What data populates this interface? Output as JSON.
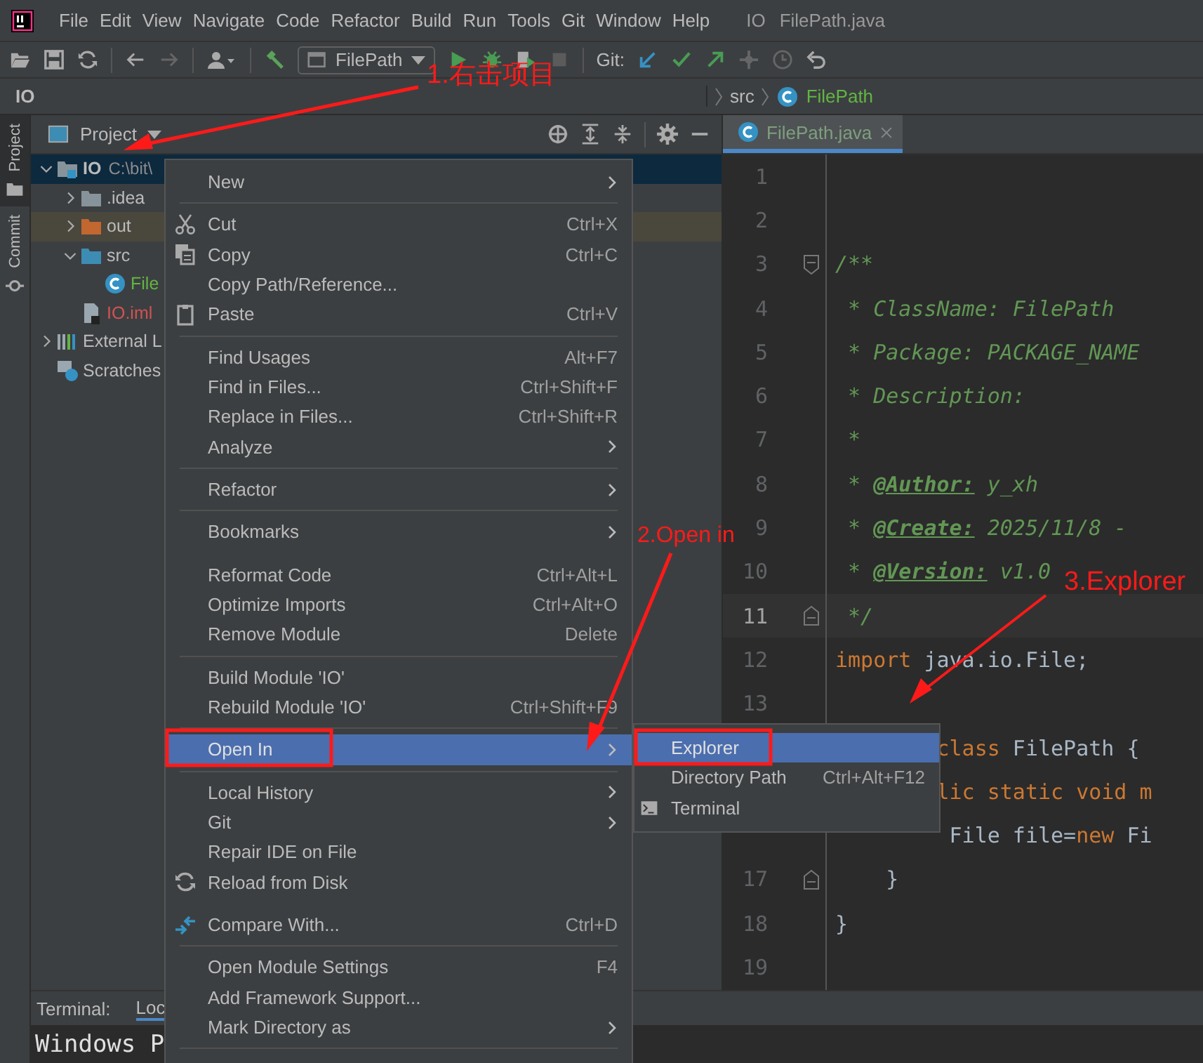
{
  "menubar": {
    "items": [
      "File",
      "Edit",
      "View",
      "Navigate",
      "Code",
      "Refactor",
      "Build",
      "Run",
      "Tools",
      "Git",
      "Window",
      "Help"
    ],
    "project": "IO",
    "file": "FilePath.java"
  },
  "toolbar": {
    "run_config": "FilePath",
    "git_label": "Git:"
  },
  "breadcrumb": [
    {
      "label": "IO",
      "kind": "project"
    },
    {
      "label": "src",
      "kind": "folder"
    },
    {
      "label": "FilePath",
      "kind": "class"
    }
  ],
  "tool_stripe": [
    {
      "label": "Project",
      "selected": true
    },
    {
      "label": "Commit",
      "selected": false
    }
  ],
  "project_panel": {
    "title": "Project",
    "tree": [
      {
        "label": "IO",
        "path": "C:\\bit\\",
        "kind": "module",
        "expanded": true,
        "selected": true,
        "children": [
          {
            "label": ".idea",
            "kind": "folder",
            "expanded": false,
            "selected": false
          },
          {
            "label": "out",
            "kind": "excluded",
            "expanded": false,
            "selected": false
          },
          {
            "label": "src",
            "kind": "source",
            "expanded": true,
            "selected": false,
            "children": [
              {
                "label": "File",
                "kind": "class",
                "selected": false
              }
            ]
          },
          {
            "label": "IO.iml",
            "kind": "iml",
            "selected": false
          }
        ]
      },
      {
        "label": "External L",
        "kind": "libraries",
        "expanded": false,
        "selected": false
      },
      {
        "label": "Scratches",
        "kind": "scratches",
        "selected": false
      }
    ]
  },
  "editor": {
    "tab": {
      "label": "FilePath.java",
      "selected": true
    },
    "lines": [
      {
        "number": "1",
        "current": false
      },
      {
        "number": "2",
        "current": false
      },
      {
        "number": "3",
        "current": false,
        "fold_start": true,
        "tokens": [
          {
            "text": "/**",
            "kind": "comment"
          }
        ]
      },
      {
        "number": "4",
        "current": false,
        "tokens": [
          {
            "text": " * ClassName: FilePath",
            "kind": "comment"
          }
        ]
      },
      {
        "number": "5",
        "current": false,
        "tokens": [
          {
            "text": " * Package: PACKAGE_NAME",
            "kind": "comment"
          }
        ]
      },
      {
        "number": "6",
        "current": false,
        "tokens": [
          {
            "text": " * Description:",
            "kind": "comment"
          }
        ]
      },
      {
        "number": "7",
        "current": false,
        "tokens": [
          {
            "text": " *",
            "kind": "comment"
          }
        ]
      },
      {
        "number": "8",
        "current": false,
        "tokens": [
          {
            "text": " * ",
            "kind": "comment"
          },
          {
            "text": "@Author:",
            "kind": "doctag"
          },
          {
            "text": " y_xh",
            "kind": "comment"
          }
        ]
      },
      {
        "number": "9",
        "current": false,
        "tokens": [
          {
            "text": " * ",
            "kind": "comment"
          },
          {
            "text": "@Create:",
            "kind": "doctag"
          },
          {
            "text": " 2025/11/8 -",
            "kind": "comment"
          }
        ]
      },
      {
        "number": "10",
        "current": false,
        "tokens": [
          {
            "text": " * ",
            "kind": "comment"
          },
          {
            "text": "@Version:",
            "kind": "doctag"
          },
          {
            "text": " v1.0",
            "kind": "comment"
          }
        ]
      },
      {
        "number": "11",
        "current": true,
        "fold_end": true,
        "tokens": [
          {
            "text": " */",
            "kind": "comment"
          }
        ]
      },
      {
        "number": "12",
        "current": false,
        "tokens": [
          {
            "text": "import",
            "kind": "keyword"
          },
          {
            "text": " java.io.File;",
            "kind": "plain"
          }
        ]
      },
      {
        "number": "13",
        "current": false
      },
      {
        "tokens": [
          {
            "text": "        class",
            "kind": "keyword"
          },
          {
            "text": " FilePath {",
            "kind": "plain"
          }
        ]
      },
      {
        "tokens": [
          {
            "text": "        lic static void m",
            "kind": "keyword"
          }
        ]
      },
      {
        "tokens": [
          {
            "text": "         File file=",
            "kind": "plain"
          },
          {
            "text": "new",
            "kind": "keyword"
          },
          {
            "text": " Fi",
            "kind": "plain"
          }
        ]
      },
      {
        "number": "17",
        "current": false,
        "fold_end": true,
        "tokens": [
          {
            "text": "    }",
            "kind": "plain"
          }
        ]
      },
      {
        "number": "18",
        "current": false,
        "tokens": [
          {
            "text": "}",
            "kind": "plain"
          }
        ]
      },
      {
        "number": "19",
        "current": false
      }
    ]
  },
  "bottom": {
    "tool_label": "Terminal:",
    "tab": "Loc",
    "terminal_text": "Windows P"
  },
  "context_menu": [
    {
      "kind": "item",
      "label": "New",
      "submenu": true,
      "selected": false
    },
    {
      "kind": "separator"
    },
    {
      "kind": "item",
      "label": "Cut",
      "shortcut": "Ctrl+X",
      "selected": false
    },
    {
      "kind": "item",
      "label": "Copy",
      "shortcut": "Ctrl+C",
      "selected": false
    },
    {
      "kind": "item",
      "label": "Copy Path/Reference...",
      "selected": false
    },
    {
      "kind": "item",
      "label": "Paste",
      "shortcut": "Ctrl+V",
      "selected": false
    },
    {
      "kind": "separator"
    },
    {
      "kind": "item",
      "label": "Find Usages",
      "shortcut": "Alt+F7",
      "selected": false
    },
    {
      "kind": "item",
      "label": "Find in Files...",
      "shortcut": "Ctrl+Shift+F",
      "selected": false
    },
    {
      "kind": "item",
      "label": "Replace in Files...",
      "shortcut": "Ctrl+Shift+R",
      "selected": false
    },
    {
      "kind": "item",
      "label": "Analyze",
      "submenu": true,
      "selected": false
    },
    {
      "kind": "separator"
    },
    {
      "kind": "item",
      "label": "Refactor",
      "submenu": true,
      "selected": false
    },
    {
      "kind": "separator"
    },
    {
      "kind": "item",
      "label": "Bookmarks",
      "submenu": true,
      "selected": false
    },
    {
      "kind": "gap"
    },
    {
      "kind": "item",
      "label": "Reformat Code",
      "shortcut": "Ctrl+Alt+L",
      "selected": false
    },
    {
      "kind": "item",
      "label": "Optimize Imports",
      "shortcut": "Ctrl+Alt+O",
      "selected": false
    },
    {
      "kind": "item",
      "label": "Remove Module",
      "shortcut": "Delete",
      "selected": false
    },
    {
      "kind": "separator"
    },
    {
      "kind": "item",
      "label": "Build Module 'IO'",
      "selected": false
    },
    {
      "kind": "item",
      "label": "Rebuild Module 'IO'",
      "shortcut": "Ctrl+Shift+F9",
      "selected": false
    },
    {
      "kind": "separator"
    },
    {
      "kind": "item",
      "label": "Open In",
      "submenu": true,
      "selected": true
    },
    {
      "kind": "separator"
    },
    {
      "kind": "item",
      "label": "Local History",
      "submenu": true,
      "selected": false
    },
    {
      "kind": "item",
      "label": "Git",
      "submenu": true,
      "selected": false
    },
    {
      "kind": "item",
      "label": "Repair IDE on File",
      "selected": false
    },
    {
      "kind": "item",
      "label": "Reload from Disk",
      "selected": false
    },
    {
      "kind": "gap"
    },
    {
      "kind": "item",
      "label": "Compare With...",
      "shortcut": "Ctrl+D",
      "selected": false
    },
    {
      "kind": "separator"
    },
    {
      "kind": "item",
      "label": "Open Module Settings",
      "shortcut": "F4",
      "selected": false
    },
    {
      "kind": "item",
      "label": "Add Framework Support...",
      "selected": false
    },
    {
      "kind": "item",
      "label": "Mark Directory as",
      "submenu": true,
      "selected": false
    },
    {
      "kind": "separator"
    }
  ],
  "submenu": [
    {
      "label": "Explorer",
      "selected": true
    },
    {
      "label": "Directory Path",
      "shortcut": "Ctrl+Alt+F12",
      "selected": false
    },
    {
      "label": "Terminal",
      "selected": false
    }
  ],
  "annotations": [
    {
      "text": "1.右击项目"
    },
    {
      "text": "2.Open in"
    },
    {
      "text": "3.Explorer"
    }
  ]
}
